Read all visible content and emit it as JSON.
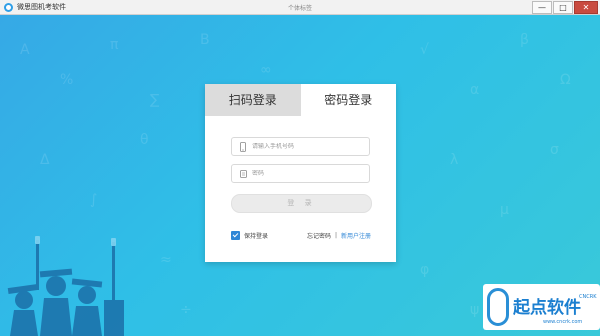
{
  "window": {
    "app_title": "微思图机考软件",
    "center_title": "个体标签",
    "minimize": "—",
    "maximize": "□",
    "close": "✕"
  },
  "login": {
    "tab_qr": "扫码登录",
    "tab_password": "密码登录",
    "phone_placeholder": "请输入手机号码",
    "password_placeholder": "密码",
    "login_button": "登 录",
    "keep_login": "保持登录",
    "forgot_password": "忘记密码",
    "separator": "|",
    "new_user_register": "新用户注册"
  },
  "watermark": {
    "brand": "起点软件",
    "tag": "CNCRK",
    "url": "www.cncrk.com"
  },
  "colors": {
    "accent": "#2f86d6",
    "background": "#36a8e6"
  }
}
